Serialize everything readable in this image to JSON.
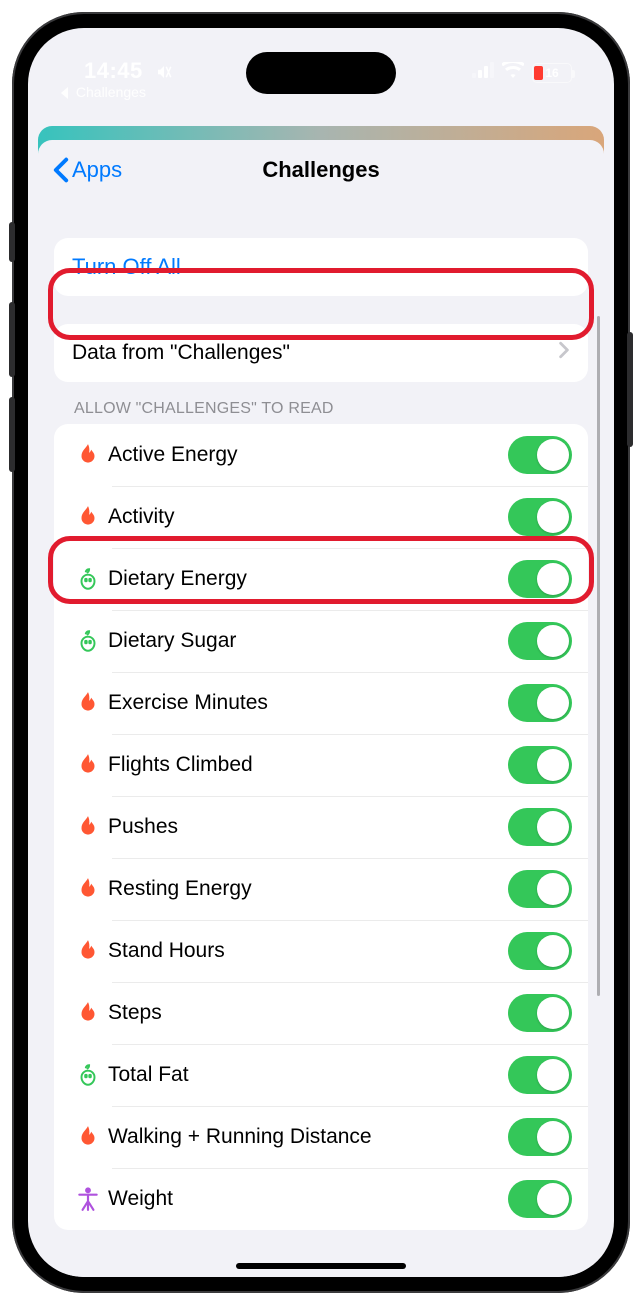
{
  "status": {
    "time": "14:45",
    "back_app": "Challenges",
    "battery_percent": "16"
  },
  "nav": {
    "back_label": "Apps",
    "title": "Challenges"
  },
  "turn_off_all": "Turn Off All",
  "data_row": "Data from \"Challenges\"",
  "section_header": "Allow \"Challenges\" to read",
  "icons": {
    "flame": "#ff5733",
    "apple": "#34c759",
    "body": "#af52de"
  },
  "permissions": [
    {
      "label": "Active Energy",
      "icon": "flame",
      "enabled": true
    },
    {
      "label": "Activity",
      "icon": "flame",
      "enabled": true
    },
    {
      "label": "Dietary Energy",
      "icon": "apple",
      "enabled": true
    },
    {
      "label": "Dietary Sugar",
      "icon": "apple",
      "enabled": true
    },
    {
      "label": "Exercise Minutes",
      "icon": "flame",
      "enabled": true
    },
    {
      "label": "Flights Climbed",
      "icon": "flame",
      "enabled": true
    },
    {
      "label": "Pushes",
      "icon": "flame",
      "enabled": true
    },
    {
      "label": "Resting Energy",
      "icon": "flame",
      "enabled": true
    },
    {
      "label": "Stand Hours",
      "icon": "flame",
      "enabled": true
    },
    {
      "label": "Steps",
      "icon": "flame",
      "enabled": true
    },
    {
      "label": "Total Fat",
      "icon": "apple",
      "enabled": true
    },
    {
      "label": "Walking + Running Distance",
      "icon": "flame",
      "enabled": true
    },
    {
      "label": "Weight",
      "icon": "body",
      "enabled": true
    }
  ]
}
